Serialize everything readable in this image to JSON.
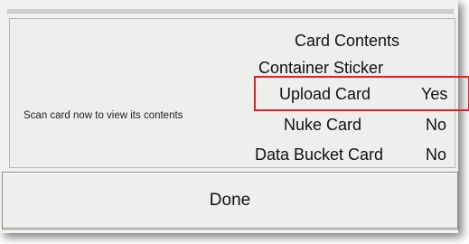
{
  "panel": {
    "hint": "Scan card now to view its contents",
    "heading": "Card Contents",
    "rows": [
      {
        "label": "Container Sticker",
        "value": ""
      },
      {
        "label": "Upload Card",
        "value": "Yes",
        "highlighted": true
      },
      {
        "label": "Nuke Card",
        "value": "No"
      },
      {
        "label": "Data Bucket Card",
        "value": "No"
      }
    ],
    "highlight_color": "#e8222a"
  },
  "actions": {
    "done_label": "Done"
  }
}
